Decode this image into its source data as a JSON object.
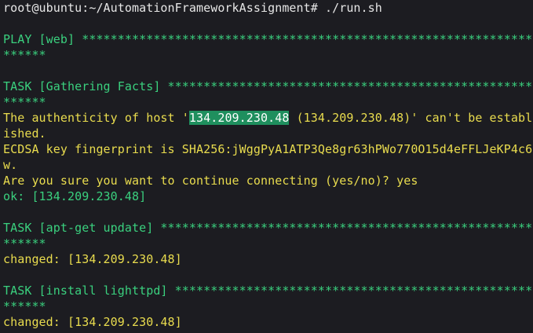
{
  "terminal": {
    "prompt_line": "root@ubuntu:~/AutomationFrameworkAssignment# ./run.sh",
    "play_line": "PLAY [web] *********************************************************************",
    "play_wrap": "******",
    "task1_line": "TASK [Gathering Facts] *********************************************************",
    "task1_wrap": "******",
    "auth_prefix": "The authenticity of host '",
    "auth_host_highlight": "134.209.230.48",
    "auth_suffix": " (134.209.230.48)' can't be establ",
    "auth_wrap": "ished.",
    "ecdsa_line": "ECDSA key fingerprint is SHA256:jWggPyA1ATP3Qe8gr63hPWo770O15d4eFFLJeKP4c6",
    "ecdsa_wrap": "w.",
    "confirm_line": "Are you sure you want to continue connecting (yes/no)? yes",
    "ok_line": "ok: [134.209.230.48]",
    "task2_line": "TASK [apt-get update] **********************************************************",
    "task2_wrap": "******",
    "changed1_line": "changed: [134.209.230.48]",
    "task3_line": "TASK [install lighttpd] ********************************************************",
    "task3_wrap": "******",
    "changed2_line": "changed: [134.209.230.48]"
  },
  "colors": {
    "background": "#1c1c21",
    "prompt_text": "#e6e6e6",
    "green_text": "#3ad07e",
    "yellow_text": "#e9dc4e",
    "selection_highlight": "#1f8f5e"
  }
}
